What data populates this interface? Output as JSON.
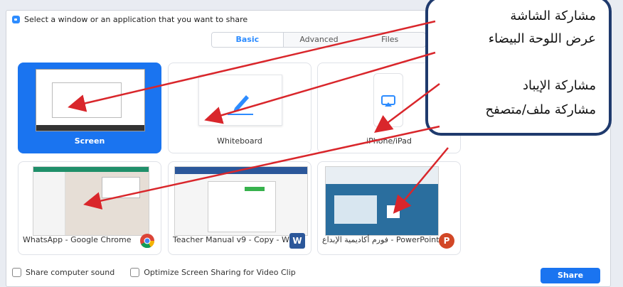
{
  "window": {
    "title": "Select a window or an application that you want to share"
  },
  "tabs": [
    {
      "label": "Basic",
      "active": true
    },
    {
      "label": "Advanced",
      "active": false
    },
    {
      "label": "Files",
      "active": false
    }
  ],
  "cards": {
    "screen": "Screen",
    "whiteboard": "Whiteboard",
    "iphone": "iPhone/iPad",
    "chrome": "WhatsApp - Google Chrome",
    "word": "Teacher Manual v9 - Copy - Word",
    "powerpoint": "فورم أكاديمية الإبداع - PowerPoint"
  },
  "bottom": {
    "sound": "Share computer sound",
    "optimize": "Optimize Screen Sharing for Video Clip",
    "share": "Share"
  },
  "callout": {
    "line1": "مشاركة الشاشة",
    "line2": "عرض اللوحة البيضاء",
    "line3": "مشاركة الإيباد",
    "line4": "مشاركة ملف/متصفح"
  },
  "colors": {
    "accent": "#1a74f0",
    "arrow": "#d9262b",
    "callout_border": "#1f3a6d"
  }
}
